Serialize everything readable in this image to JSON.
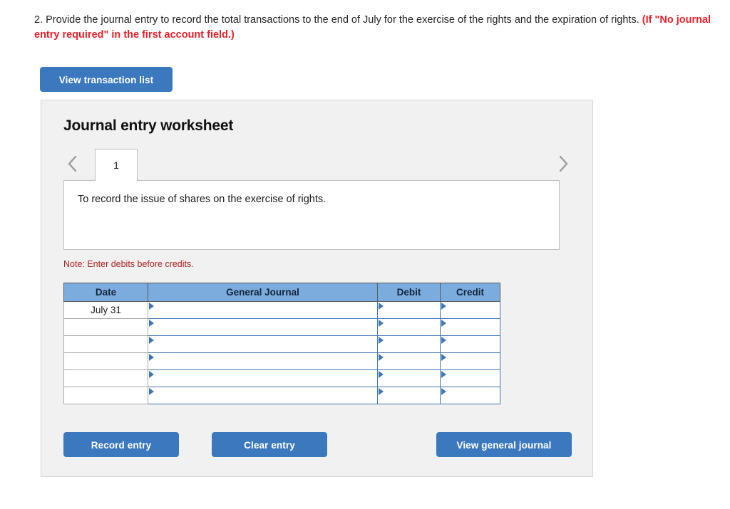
{
  "question": {
    "number": "2.",
    "text": "Provide the journal entry to record the total transactions to the end of July for the exercise of the rights and the expiration of rights.",
    "required_note": "(If \"No journal entry required\" in the first account field.)"
  },
  "toolbar": {
    "view_transaction_list": "View transaction list"
  },
  "worksheet": {
    "title": "Journal entry worksheet",
    "prev_icon": "chevron-left-icon",
    "next_icon": "chevron-right-icon",
    "tabs": [
      {
        "label": "1",
        "active": true
      }
    ],
    "description": "To record the issue of shares on the exercise of rights.",
    "note": "Note: Enter debits before credits."
  },
  "table": {
    "columns": [
      "Date",
      "General Journal",
      "Debit",
      "Credit"
    ],
    "rows": [
      {
        "date": "July 31",
        "journal": "",
        "debit": "",
        "credit": ""
      },
      {
        "date": "",
        "journal": "",
        "debit": "",
        "credit": ""
      },
      {
        "date": "",
        "journal": "",
        "debit": "",
        "credit": ""
      },
      {
        "date": "",
        "journal": "",
        "debit": "",
        "credit": ""
      },
      {
        "date": "",
        "journal": "",
        "debit": "",
        "credit": ""
      },
      {
        "date": "",
        "journal": "",
        "debit": "",
        "credit": ""
      }
    ]
  },
  "actions": {
    "record_entry": "Record entry",
    "clear_entry": "Clear entry",
    "view_general_journal": "View general journal"
  },
  "colors": {
    "button_blue": "#3b78bd",
    "header_blue": "#7cabdd",
    "input_border_blue": "#3f76b4",
    "alert_red": "#e8202a",
    "note_red": "#ad2121",
    "panel_gray": "#f1f1f1"
  }
}
